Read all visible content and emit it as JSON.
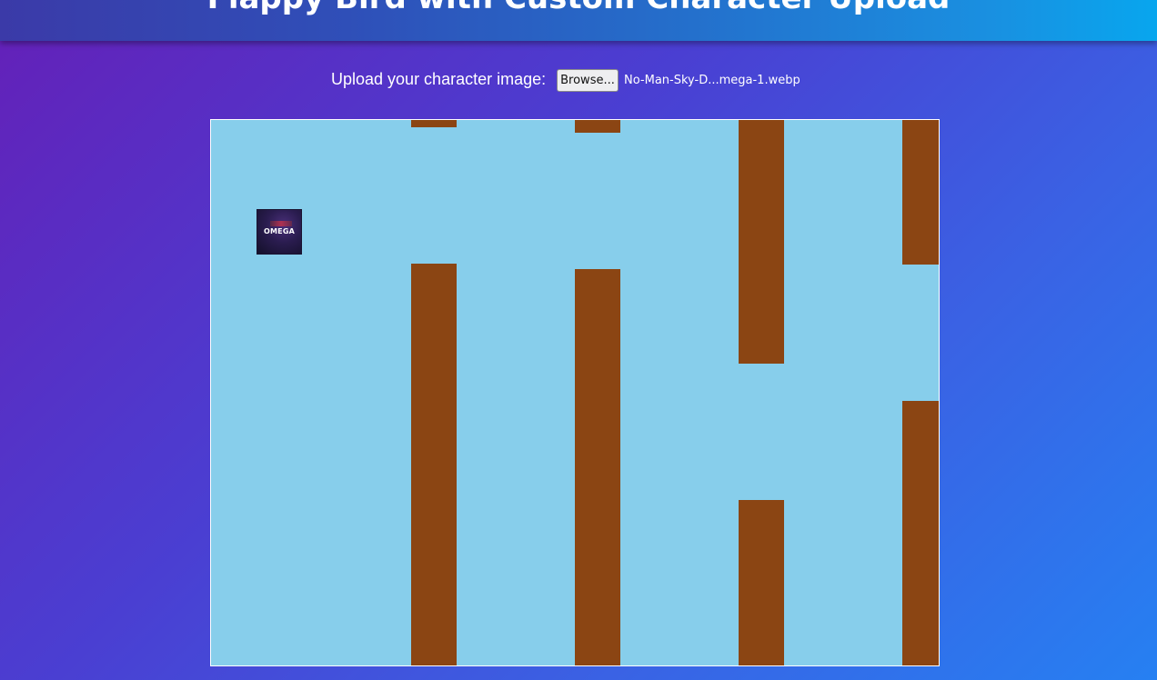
{
  "header": {
    "title": "Flappy Bird with Custom Character Upload"
  },
  "upload": {
    "label": "Upload your character image:",
    "button_label": "Browse...",
    "file_name": "No-Man-Sky-D...mega-1.webp"
  },
  "game": {
    "sky_color": "#87ceeb",
    "pipe_color": "#8b4513",
    "character": {
      "text": "OMEGA"
    }
  }
}
